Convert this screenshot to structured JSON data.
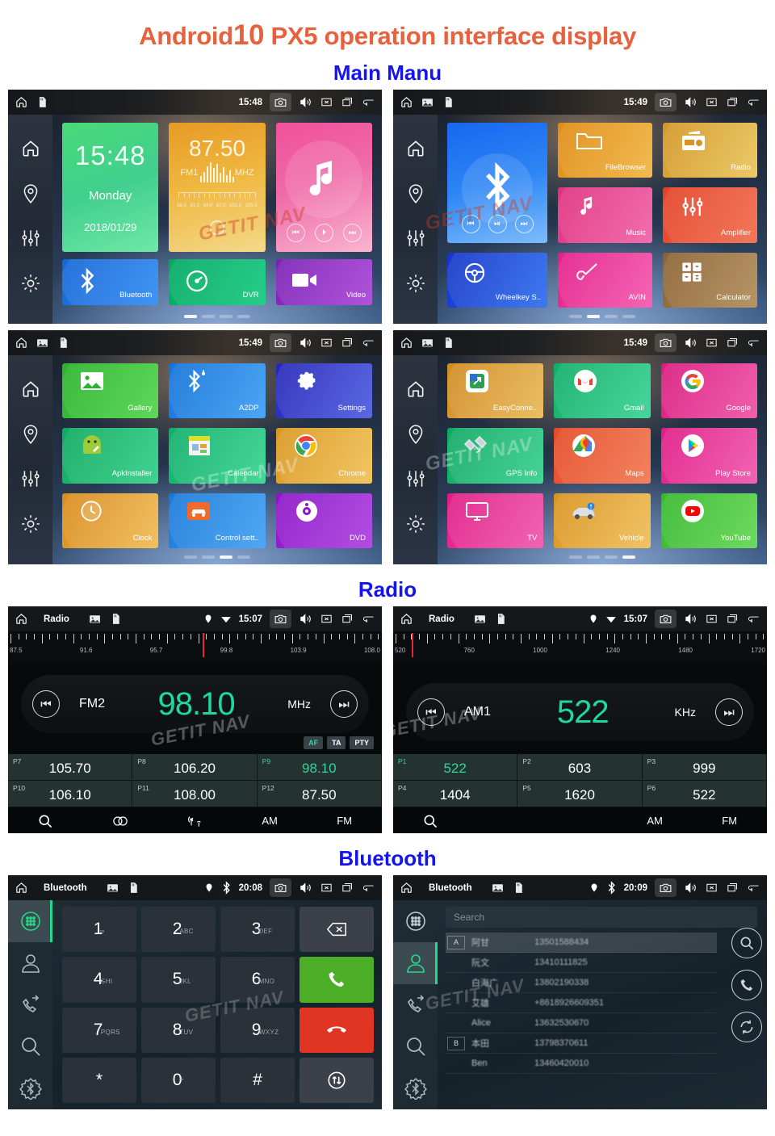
{
  "header": {
    "title_prefix": "Android",
    "title_version": "10",
    "title_suffix": " PX5 operation interface display"
  },
  "sections": {
    "main_menu": "Main Manu",
    "radio": "Radio",
    "bluetooth": "Bluetooth"
  },
  "watermark": "GETIT NAV",
  "colors": {
    "title": "#e8603c",
    "section": "#1414ee",
    "radio_accent": "#1fd7a0",
    "call_green": "#4caf27",
    "call_red": "#e03522"
  },
  "status_icons": {
    "home": "home-icon",
    "sd": "sd-card-icon",
    "image": "image-icon",
    "gps": "location-pin-icon",
    "wifi": "wifi-icon",
    "bluetooth": "bluetooth-icon",
    "camera": "camera-icon",
    "volume": "volume-icon",
    "close": "close-box-icon",
    "recents": "recents-icon",
    "back": "back-arrow-icon"
  },
  "panels": {
    "home1": {
      "status": {
        "time": "15:48",
        "title": ""
      },
      "clock_widget": {
        "time": "15:48",
        "day": "Monday",
        "date": "2018/01/29"
      },
      "radio_widget": {
        "freq": "87.50",
        "band": "FM1",
        "unit": "MHZ",
        "scale": [
          "88.0",
          "91.0",
          "94.0",
          "97.0",
          "101.0",
          "105.0"
        ]
      },
      "tiles": [
        {
          "label": "Bluetooth",
          "icon": "bluetooth-icon"
        },
        {
          "label": "DVR",
          "icon": "dvr-gauge-icon"
        },
        {
          "label": "Video",
          "icon": "video-camera-icon"
        }
      ],
      "page_dots": 4,
      "active_dot": 0
    },
    "home2": {
      "status": {
        "time": "15:49"
      },
      "bt_widget": {
        "icon": "bluetooth-icon"
      },
      "tiles": [
        {
          "label": "FileBrowser",
          "icon": "folder-icon"
        },
        {
          "label": "Radio",
          "icon": "radio-icon"
        },
        {
          "label": "Music",
          "icon": "music-note-icon"
        },
        {
          "label": "Amplifier",
          "icon": "sliders-icon"
        },
        {
          "label": "Wheelkey S..",
          "icon": "steering-wheel-icon"
        },
        {
          "label": "AVIN",
          "icon": "av-plug-icon"
        },
        {
          "label": "Calculator",
          "icon": "calculator-icon"
        }
      ],
      "page_dots": 4,
      "active_dot": 1
    },
    "home3": {
      "status": {
        "time": "15:49"
      },
      "tiles": [
        {
          "label": "Gallery",
          "icon": "gallery-icon"
        },
        {
          "label": "A2DP",
          "icon": "bluetooth-audio-icon"
        },
        {
          "label": "Settings",
          "icon": "gear-icon"
        },
        {
          "label": "ApkInstaller",
          "icon": "android-wrench-icon"
        },
        {
          "label": "Calendar",
          "icon": "calendar-icon"
        },
        {
          "label": "Chrome",
          "icon": "chrome-icon"
        },
        {
          "label": "Clock",
          "icon": "clock-icon"
        },
        {
          "label": "Control sett..",
          "icon": "car-settings-icon"
        },
        {
          "label": "DVD",
          "icon": "dvd-disc-icon"
        }
      ],
      "page_dots": 4,
      "active_dot": 2
    },
    "home4": {
      "status": {
        "time": "15:49"
      },
      "tiles": [
        {
          "label": "EasyConne..",
          "icon": "easyconnect-icon"
        },
        {
          "label": "Gmail",
          "icon": "gmail-icon"
        },
        {
          "label": "Google",
          "icon": "google-icon"
        },
        {
          "label": "GPS Info",
          "icon": "satellite-icon"
        },
        {
          "label": "Maps",
          "icon": "maps-icon"
        },
        {
          "label": "Play Store",
          "icon": "play-store-icon"
        },
        {
          "label": "TV",
          "icon": "tv-icon"
        },
        {
          "label": "Vehicle",
          "icon": "vehicle-icon"
        },
        {
          "label": "YouTube",
          "icon": "youtube-icon"
        }
      ],
      "page_dots": 4,
      "active_dot": 3
    },
    "radio_fm": {
      "status": {
        "title": "Radio",
        "time": "15:07"
      },
      "scale_labels": [
        "87.5",
        "91.6",
        "95.7",
        "99.8",
        "103.9",
        "108.0"
      ],
      "needle_pct": 52,
      "band": "FM2",
      "frequency": "98.10",
      "unit": "MHz",
      "rds": [
        "AF",
        "TA",
        "PTY"
      ],
      "presets": [
        {
          "name": "P7",
          "value": "105.70",
          "active": false
        },
        {
          "name": "P8",
          "value": "106.20",
          "active": false
        },
        {
          "name": "P9",
          "value": "98.10",
          "active": true
        },
        {
          "name": "P10",
          "value": "106.10",
          "active": false
        },
        {
          "name": "P11",
          "value": "108.00",
          "active": false
        },
        {
          "name": "P12",
          "value": "87.50",
          "active": false
        }
      ],
      "toolbar": [
        {
          "label": "",
          "icon": "search-icon"
        },
        {
          "label": "",
          "icon": "stereo-icon"
        },
        {
          "label": "",
          "icon": "antenna-icon"
        },
        {
          "label": "AM",
          "icon": ""
        },
        {
          "label": "FM",
          "icon": ""
        }
      ]
    },
    "radio_am": {
      "status": {
        "title": "Radio",
        "time": "15:07"
      },
      "scale_labels": [
        "520",
        "760",
        "1000",
        "1240",
        "1480",
        "1720"
      ],
      "needle_pct": 5,
      "band": "AM1",
      "frequency": "522",
      "unit": "KHz",
      "presets": [
        {
          "name": "P1",
          "value": "522",
          "active": true
        },
        {
          "name": "P2",
          "value": "603",
          "active": false
        },
        {
          "name": "P3",
          "value": "999",
          "active": false
        },
        {
          "name": "P4",
          "value": "1404",
          "active": false
        },
        {
          "name": "P5",
          "value": "1620",
          "active": false
        },
        {
          "name": "P6",
          "value": "522",
          "active": false
        }
      ],
      "toolbar": [
        {
          "label": "",
          "icon": "search-icon"
        },
        {
          "label": "",
          "icon": ""
        },
        {
          "label": "",
          "icon": ""
        },
        {
          "label": "AM",
          "icon": ""
        },
        {
          "label": "FM",
          "icon": ""
        }
      ]
    },
    "bt_dialpad": {
      "status": {
        "title": "Bluetooth",
        "time": "20:08"
      },
      "side_items": [
        {
          "icon": "dialpad-icon",
          "selected": true
        },
        {
          "icon": "contacts-icon",
          "selected": false
        },
        {
          "icon": "call-log-icon",
          "selected": false
        },
        {
          "icon": "search-icon",
          "selected": false
        },
        {
          "icon": "bt-settings-icon",
          "selected": false
        }
      ],
      "keys": [
        {
          "num": "1",
          "sub": "∞"
        },
        {
          "num": "2",
          "sub": "ABC"
        },
        {
          "num": "3",
          "sub": "DEF"
        },
        {
          "num": "",
          "sub": "",
          "icon": "backspace-icon",
          "kind": "fn"
        },
        {
          "num": "4",
          "sub": "GHI"
        },
        {
          "num": "5",
          "sub": "JKL"
        },
        {
          "num": "6",
          "sub": "MNO"
        },
        {
          "num": "",
          "sub": "",
          "icon": "call-answer-icon",
          "kind": "green"
        },
        {
          "num": "7",
          "sub": "PQRS"
        },
        {
          "num": "8",
          "sub": "TUV"
        },
        {
          "num": "9",
          "sub": "WXYZ"
        },
        {
          "num": "",
          "sub": "",
          "icon": "call-end-icon",
          "kind": "red"
        },
        {
          "num": "*",
          "sub": ""
        },
        {
          "num": "0",
          "sub": "+"
        },
        {
          "num": "#",
          "sub": ""
        },
        {
          "num": "",
          "sub": "",
          "icon": "transfer-audio-icon",
          "kind": "fn"
        }
      ]
    },
    "bt_contacts": {
      "status": {
        "title": "Bluetooth",
        "time": "20:09"
      },
      "search_placeholder": "Search",
      "side_items": [
        {
          "icon": "dialpad-icon",
          "selected": false
        },
        {
          "icon": "contacts-icon",
          "selected": true
        },
        {
          "icon": "call-log-icon",
          "selected": false
        },
        {
          "icon": "search-icon",
          "selected": false
        },
        {
          "icon": "bt-settings-icon",
          "selected": false
        }
      ],
      "contacts": [
        {
          "index": "A",
          "name": "阿甘",
          "number": "13501588434",
          "selected": true
        },
        {
          "index": "",
          "name": "阮文",
          "number": "13410111825",
          "selected": false
        },
        {
          "index": "",
          "name": "白海广",
          "number": "13802190338",
          "selected": false
        },
        {
          "index": "",
          "name": "艾雄",
          "number": "+8618926609351",
          "selected": false
        },
        {
          "index": "",
          "name": "Alice",
          "number": "13632530670",
          "selected": false
        },
        {
          "index": "B",
          "name": "本田",
          "number": "13798370611",
          "selected": false
        },
        {
          "index": "",
          "name": "Ben",
          "number": "13460420010",
          "selected": false
        }
      ],
      "actions": [
        {
          "icon": "search-icon"
        },
        {
          "icon": "call-icon"
        },
        {
          "icon": "sync-icon"
        }
      ]
    }
  }
}
